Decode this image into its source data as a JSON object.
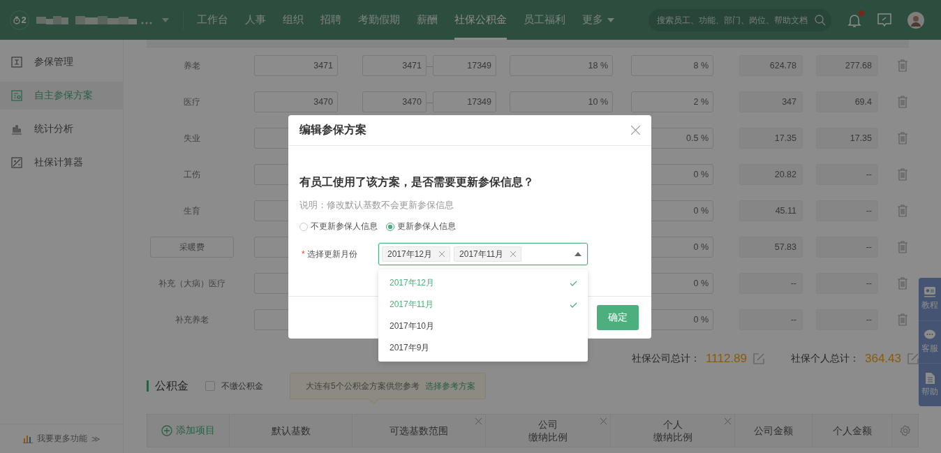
{
  "topbar": {
    "logo_mark": "2",
    "nav": [
      {
        "label": "工作台",
        "selected": false,
        "kind": "link"
      },
      {
        "label": "人事",
        "selected": false,
        "kind": "link"
      },
      {
        "label": "组织",
        "selected": false,
        "kind": "link"
      },
      {
        "label": "招聘",
        "selected": false,
        "kind": "link"
      },
      {
        "label": "考勤假期",
        "selected": false,
        "kind": "link"
      },
      {
        "label": "薪酬",
        "selected": false,
        "kind": "link"
      },
      {
        "label": "社保公积金",
        "selected": true,
        "kind": "link"
      },
      {
        "label": "员工福利",
        "selected": false,
        "kind": "link"
      },
      {
        "label": "更多",
        "selected": false,
        "kind": "menu"
      }
    ],
    "search": {
      "placeholder": "搜索员工、功能、部门、岗位、帮助文档"
    },
    "notifications": {
      "unread": true
    }
  },
  "sidebar": {
    "items": [
      {
        "label": "参保管理",
        "selected": false
      },
      {
        "label": "自主参保方案",
        "selected": true
      },
      {
        "label": "统计分析",
        "selected": false
      },
      {
        "label": "社保计算器",
        "selected": false
      }
    ],
    "footer_link": {
      "label": "我要更多功能",
      "arrow": "≫"
    }
  },
  "social_table": {
    "rows": [
      {
        "name": "养老",
        "kind": "default",
        "base": "3471",
        "range_min": "3471",
        "range_sep": "—",
        "range_max": "17349",
        "company_ratio": "18 %",
        "personal_ratio": "8 %",
        "company_amount": "624.78",
        "personal_amount": "277.68"
      },
      {
        "name": "医疗",
        "kind": "default",
        "base": "3470",
        "range_min": "3470",
        "range_sep": "—",
        "range_max": "17349",
        "company_ratio": "10 %",
        "personal_ratio": "2 %",
        "company_amount": "347",
        "personal_amount": "69.4"
      },
      {
        "name": "失业",
        "kind": "default",
        "personal_ratio": "0.5 %",
        "company_amount": "17.35",
        "personal_amount": "17.35"
      },
      {
        "name": "工伤",
        "kind": "default",
        "personal_ratio": "0 %",
        "company_amount": "20.82",
        "personal_amount": "--"
      },
      {
        "name": "生育",
        "kind": "default",
        "personal_ratio": "0 %",
        "company_amount": "45.11",
        "personal_amount": "--"
      },
      {
        "name": "采暖费",
        "kind": "custom",
        "personal_ratio": "0 %",
        "company_amount": "57.83",
        "personal_amount": "--"
      },
      {
        "name": "补充（大病）医疗",
        "kind": "default",
        "personal_ratio": "0 %",
        "company_amount": "--",
        "personal_amount": "--"
      },
      {
        "name": "补充养老",
        "kind": "default",
        "personal_ratio": "0 %",
        "company_amount": "--",
        "personal_amount": "--"
      }
    ]
  },
  "totals": [
    {
      "label": "社保公司总计：",
      "value": "1112.89"
    },
    {
      "label": "社保个人总计：",
      "value": "364.43"
    }
  ],
  "fund": {
    "title": "公积金",
    "opt_out": {
      "label": "不缴公积金",
      "checked": false
    },
    "tip": {
      "text": "大连有5个公积金方案供您参考",
      "link": "选择参考方案"
    },
    "header": {
      "add": "添加项目",
      "columns": [
        {
          "lines": [
            "默认基数"
          ],
          "removable": false
        },
        {
          "lines": [
            "可选基数范围"
          ],
          "removable": true
        },
        {
          "lines": [
            "公司",
            "缴纳比例"
          ],
          "removable": true
        },
        {
          "lines": [
            "个人",
            "缴纳比例"
          ],
          "removable": true
        },
        {
          "lines": [
            "公司金额"
          ],
          "removable": false
        },
        {
          "lines": [
            "个人金额"
          ],
          "removable": false
        }
      ]
    }
  },
  "help_panel": [
    {
      "label": "教程"
    },
    {
      "label": "客服"
    },
    {
      "label": "帮助"
    }
  ],
  "dialog": {
    "title": "编辑参保方案",
    "question": "有员工使用了该方案，是否需要更新参保信息？",
    "note": "说明：修改默认基数不会更新参保信息",
    "options": [
      {
        "label": "不更新参保人信息",
        "selected": false
      },
      {
        "label": "更新参保人信息",
        "selected": true
      }
    ],
    "field": {
      "label": "选择更新月份",
      "required_mark": "*",
      "tags": [
        "2017年12月",
        "2017年11月"
      ],
      "open": true
    },
    "dropdown": [
      {
        "label": "2017年12月",
        "selected": true
      },
      {
        "label": "2017年11月",
        "selected": true
      },
      {
        "label": "2017年10月",
        "selected": false
      },
      {
        "label": "2017年9月",
        "selected": false
      }
    ],
    "confirm": "确定"
  }
}
